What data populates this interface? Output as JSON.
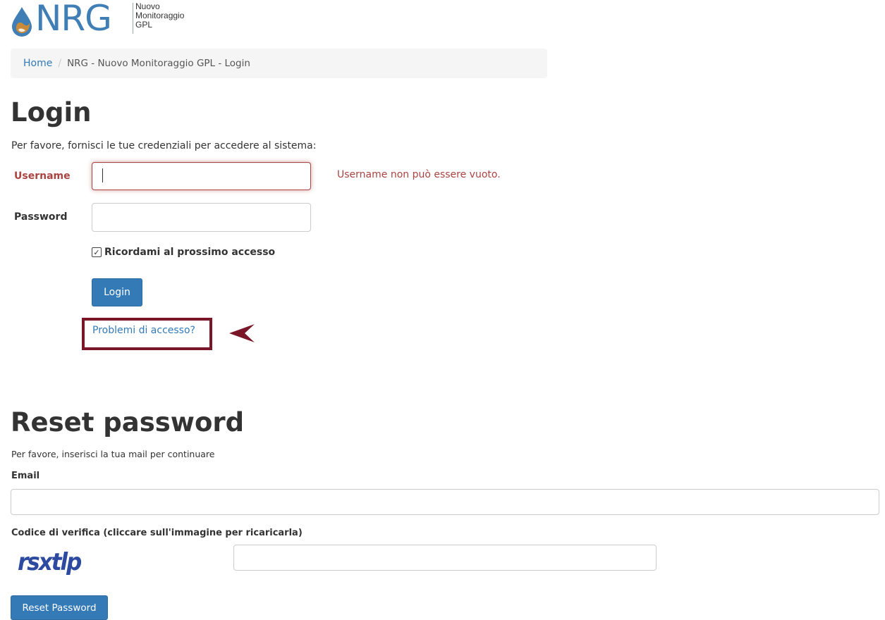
{
  "logo": {
    "letters": "NRG",
    "subtitle_lines": [
      "Nuovo",
      "Monitoraggio",
      "GPL"
    ]
  },
  "breadcrumb": {
    "home": "Home",
    "separator": "/",
    "current": "NRG - Nuovo Monitoraggio GPL - Login"
  },
  "login": {
    "title": "Login",
    "intro": "Per favore, fornisci le tue credenziali per accedere al sistema:",
    "username_label": "Username",
    "username_value": "",
    "username_error": "Username non può essere vuoto.",
    "password_label": "Password",
    "password_value": "",
    "remember_label": "Ricordami al prossimo accesso",
    "remember_checked": true,
    "submit_label": "Login",
    "access_problems_link": "Problemi di accesso?"
  },
  "reset": {
    "title": "Reset password",
    "intro": "Per favore, inserisci la tua mail per continuare",
    "email_label": "Email",
    "email_value": "",
    "captcha_label": "Codice di verifica (cliccare sull'immagine per ricaricarla)",
    "captcha_text": "rsxtlp",
    "captcha_value": "",
    "submit_label": "Reset Password"
  },
  "colors": {
    "primary": "#337ab7",
    "error": "#a94442",
    "highlight": "#7a1628"
  }
}
